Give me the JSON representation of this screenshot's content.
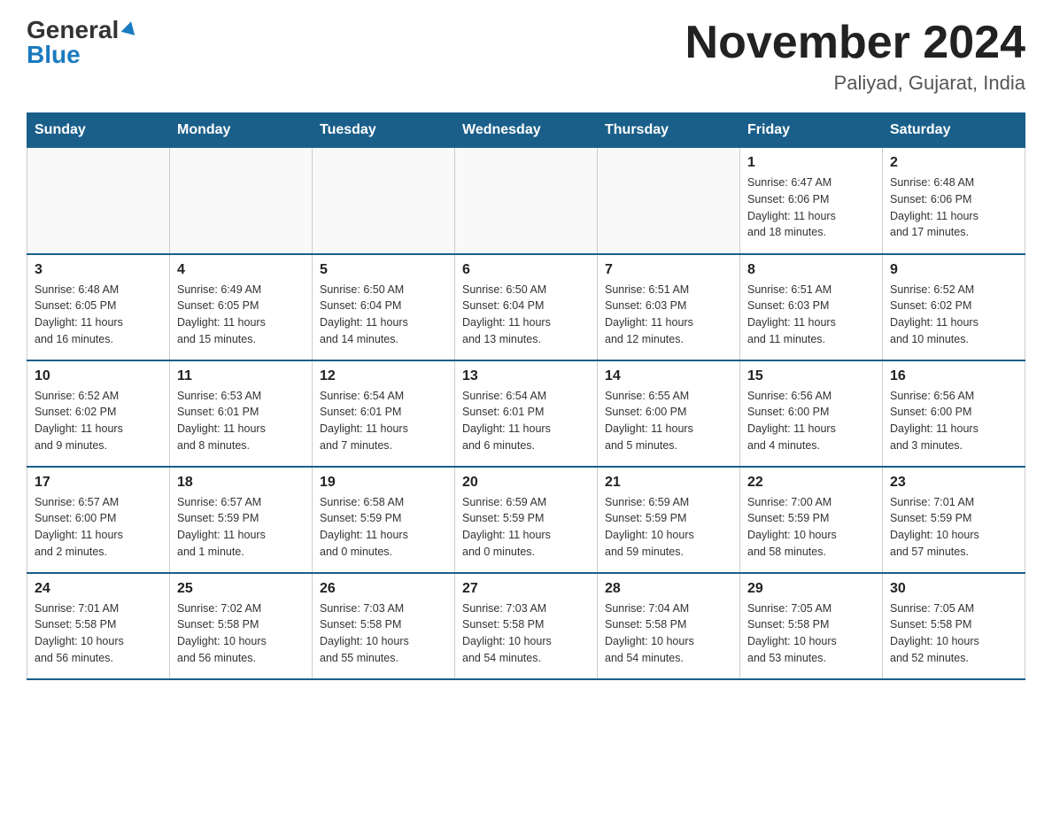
{
  "header": {
    "logo_general": "General",
    "logo_blue": "Blue",
    "title": "November 2024",
    "location": "Paliyad, Gujarat, India"
  },
  "weekdays": [
    "Sunday",
    "Monday",
    "Tuesday",
    "Wednesday",
    "Thursday",
    "Friday",
    "Saturday"
  ],
  "weeks": [
    [
      {
        "day": "",
        "info": ""
      },
      {
        "day": "",
        "info": ""
      },
      {
        "day": "",
        "info": ""
      },
      {
        "day": "",
        "info": ""
      },
      {
        "day": "",
        "info": ""
      },
      {
        "day": "1",
        "info": "Sunrise: 6:47 AM\nSunset: 6:06 PM\nDaylight: 11 hours\nand 18 minutes."
      },
      {
        "day": "2",
        "info": "Sunrise: 6:48 AM\nSunset: 6:06 PM\nDaylight: 11 hours\nand 17 minutes."
      }
    ],
    [
      {
        "day": "3",
        "info": "Sunrise: 6:48 AM\nSunset: 6:05 PM\nDaylight: 11 hours\nand 16 minutes."
      },
      {
        "day": "4",
        "info": "Sunrise: 6:49 AM\nSunset: 6:05 PM\nDaylight: 11 hours\nand 15 minutes."
      },
      {
        "day": "5",
        "info": "Sunrise: 6:50 AM\nSunset: 6:04 PM\nDaylight: 11 hours\nand 14 minutes."
      },
      {
        "day": "6",
        "info": "Sunrise: 6:50 AM\nSunset: 6:04 PM\nDaylight: 11 hours\nand 13 minutes."
      },
      {
        "day": "7",
        "info": "Sunrise: 6:51 AM\nSunset: 6:03 PM\nDaylight: 11 hours\nand 12 minutes."
      },
      {
        "day": "8",
        "info": "Sunrise: 6:51 AM\nSunset: 6:03 PM\nDaylight: 11 hours\nand 11 minutes."
      },
      {
        "day": "9",
        "info": "Sunrise: 6:52 AM\nSunset: 6:02 PM\nDaylight: 11 hours\nand 10 minutes."
      }
    ],
    [
      {
        "day": "10",
        "info": "Sunrise: 6:52 AM\nSunset: 6:02 PM\nDaylight: 11 hours\nand 9 minutes."
      },
      {
        "day": "11",
        "info": "Sunrise: 6:53 AM\nSunset: 6:01 PM\nDaylight: 11 hours\nand 8 minutes."
      },
      {
        "day": "12",
        "info": "Sunrise: 6:54 AM\nSunset: 6:01 PM\nDaylight: 11 hours\nand 7 minutes."
      },
      {
        "day": "13",
        "info": "Sunrise: 6:54 AM\nSunset: 6:01 PM\nDaylight: 11 hours\nand 6 minutes."
      },
      {
        "day": "14",
        "info": "Sunrise: 6:55 AM\nSunset: 6:00 PM\nDaylight: 11 hours\nand 5 minutes."
      },
      {
        "day": "15",
        "info": "Sunrise: 6:56 AM\nSunset: 6:00 PM\nDaylight: 11 hours\nand 4 minutes."
      },
      {
        "day": "16",
        "info": "Sunrise: 6:56 AM\nSunset: 6:00 PM\nDaylight: 11 hours\nand 3 minutes."
      }
    ],
    [
      {
        "day": "17",
        "info": "Sunrise: 6:57 AM\nSunset: 6:00 PM\nDaylight: 11 hours\nand 2 minutes."
      },
      {
        "day": "18",
        "info": "Sunrise: 6:57 AM\nSunset: 5:59 PM\nDaylight: 11 hours\nand 1 minute."
      },
      {
        "day": "19",
        "info": "Sunrise: 6:58 AM\nSunset: 5:59 PM\nDaylight: 11 hours\nand 0 minutes."
      },
      {
        "day": "20",
        "info": "Sunrise: 6:59 AM\nSunset: 5:59 PM\nDaylight: 11 hours\nand 0 minutes."
      },
      {
        "day": "21",
        "info": "Sunrise: 6:59 AM\nSunset: 5:59 PM\nDaylight: 10 hours\nand 59 minutes."
      },
      {
        "day": "22",
        "info": "Sunrise: 7:00 AM\nSunset: 5:59 PM\nDaylight: 10 hours\nand 58 minutes."
      },
      {
        "day": "23",
        "info": "Sunrise: 7:01 AM\nSunset: 5:59 PM\nDaylight: 10 hours\nand 57 minutes."
      }
    ],
    [
      {
        "day": "24",
        "info": "Sunrise: 7:01 AM\nSunset: 5:58 PM\nDaylight: 10 hours\nand 56 minutes."
      },
      {
        "day": "25",
        "info": "Sunrise: 7:02 AM\nSunset: 5:58 PM\nDaylight: 10 hours\nand 56 minutes."
      },
      {
        "day": "26",
        "info": "Sunrise: 7:03 AM\nSunset: 5:58 PM\nDaylight: 10 hours\nand 55 minutes."
      },
      {
        "day": "27",
        "info": "Sunrise: 7:03 AM\nSunset: 5:58 PM\nDaylight: 10 hours\nand 54 minutes."
      },
      {
        "day": "28",
        "info": "Sunrise: 7:04 AM\nSunset: 5:58 PM\nDaylight: 10 hours\nand 54 minutes."
      },
      {
        "day": "29",
        "info": "Sunrise: 7:05 AM\nSunset: 5:58 PM\nDaylight: 10 hours\nand 53 minutes."
      },
      {
        "day": "30",
        "info": "Sunrise: 7:05 AM\nSunset: 5:58 PM\nDaylight: 10 hours\nand 52 minutes."
      }
    ]
  ]
}
